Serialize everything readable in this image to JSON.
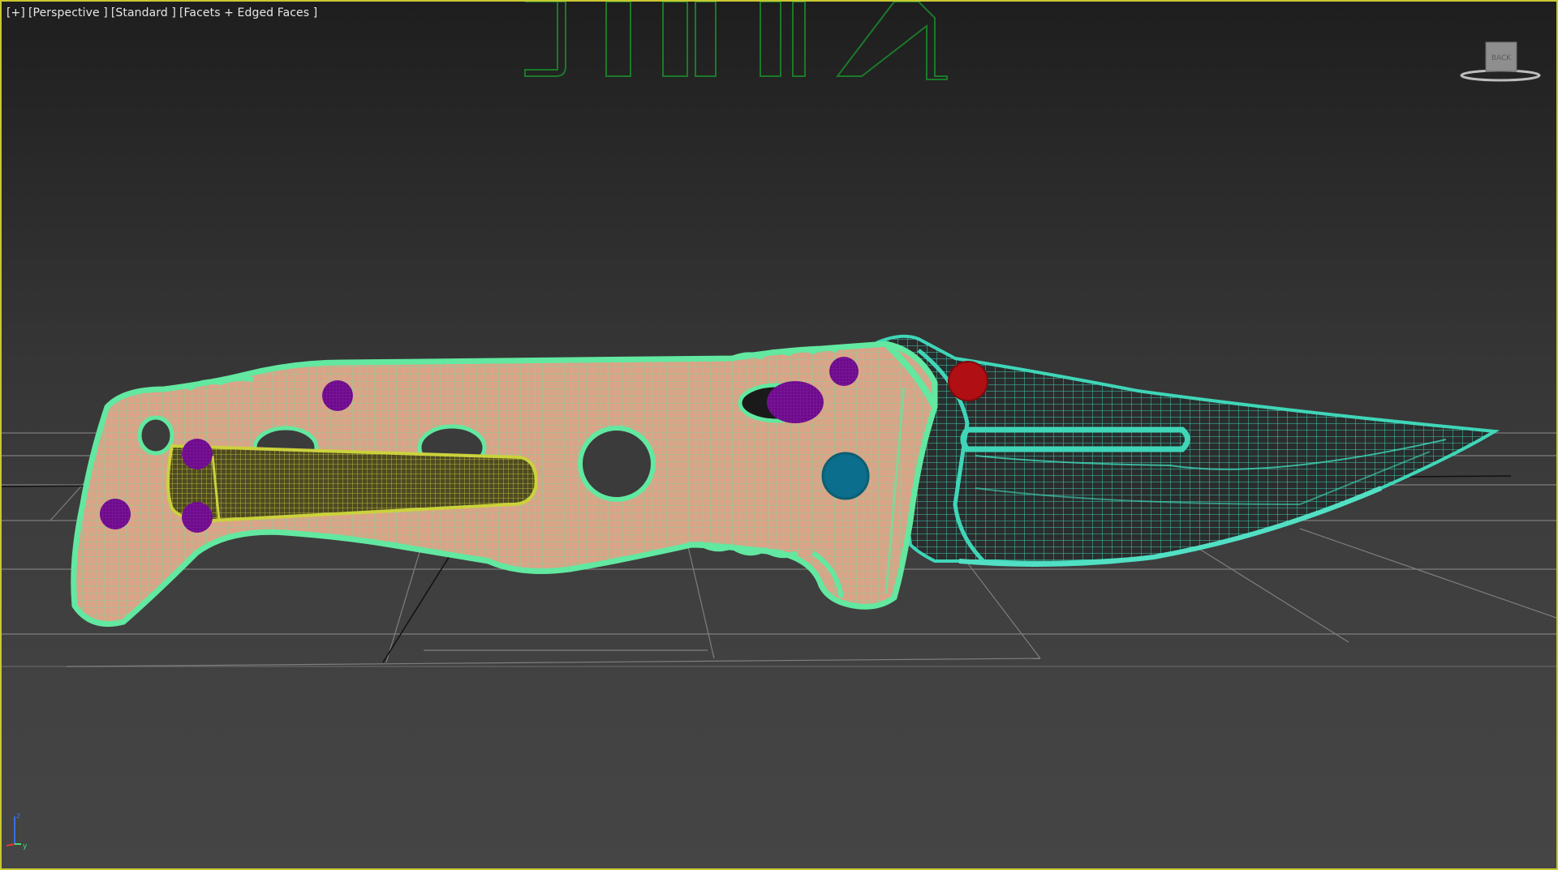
{
  "viewport": {
    "labels": {
      "plus": "[+]",
      "view": "[Perspective ]",
      "shading_mode": "[Standard ]",
      "display_mode": "[Facets + Edged Faces ]"
    },
    "viewcube_face": "BACK",
    "axis_gizmo": {
      "z": "z",
      "y": "y"
    },
    "watermark_text": "JINX"
  },
  "colors": {
    "selection_border": "#c8c832",
    "handle_fill": "#e8a98a",
    "handle_wire": "#62e8a0",
    "blade_wire": "#3fd6b8",
    "clip_wire": "#c8d23a",
    "screw_purple": "#6e0a8c",
    "screw_teal": "#0a6e8c",
    "pin_red": "#b00f14",
    "grid": "#8a8a8a",
    "watermark": "#1a7a2a"
  },
  "scene_objects": [
    {
      "name": "handle",
      "type": "editable_poly"
    },
    {
      "name": "blade",
      "type": "editable_poly"
    },
    {
      "name": "pocket-clip",
      "type": "editable_poly"
    },
    {
      "name": "screws",
      "count": 6
    },
    {
      "name": "thumb-stud",
      "count": 1
    },
    {
      "name": "pivot-pin",
      "count": 1
    }
  ]
}
